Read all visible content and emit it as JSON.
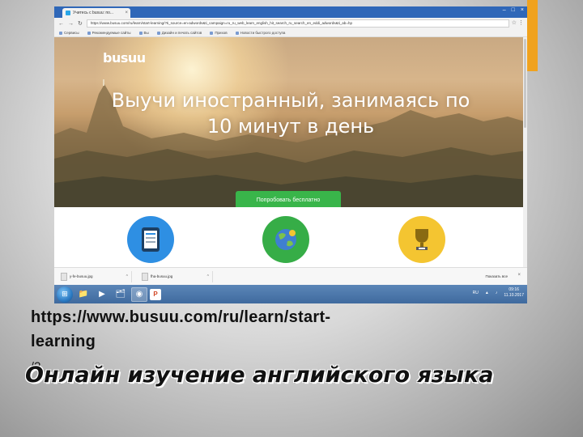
{
  "browser": {
    "tab_title": "Учитесь с busuu: по...",
    "url": "https://www.busuu.com/ru/learn/start-learning/?ti_source=en-adwords&ti_campaign=ru_ru_web_learn_english_hit_search_ru_search_en_eddi_adwords&ti_ab=hp",
    "bookmarks": [
      "Сервисы",
      "Рекомендуемые сайты",
      "Вы",
      "Дизайн и печать сайтов",
      "Прихов",
      "Новости быстрого доступа"
    ],
    "downloads": [
      "y-fe-busuu.jpg",
      "fha-busuu.jpg"
    ],
    "show_all_downloads": "Показать все"
  },
  "page": {
    "logo": "busuu",
    "headline_line1": "Выучи иностранный, занимаясь по",
    "headline_line2": "10 минут в день",
    "cta": "Попробовать бесплатно"
  },
  "taskbar": {
    "lang": "RU",
    "time": "09:16",
    "date": "11.10.2017"
  },
  "caption": {
    "url_line1": "https://www.busuu.com/ru/learn/start-",
    "url_line2": "learning",
    "url_suffix": "/?",
    "title": "Онлайн изучение английского языка"
  },
  "colors": {
    "accent": "#f0a21e",
    "cta": "#39b54a",
    "feature_blue": "#2e8fe3",
    "feature_green": "#36ad47",
    "feature_yellow": "#f4c531"
  },
  "icons": [
    "back-icon",
    "forward-icon",
    "reload-icon",
    "star-icon",
    "menu-icon",
    "tablet-icon",
    "globe-icon",
    "trophy-icon",
    "windows-start-icon",
    "explorer-icon",
    "chrome-icon",
    "powerpoint-icon"
  ]
}
